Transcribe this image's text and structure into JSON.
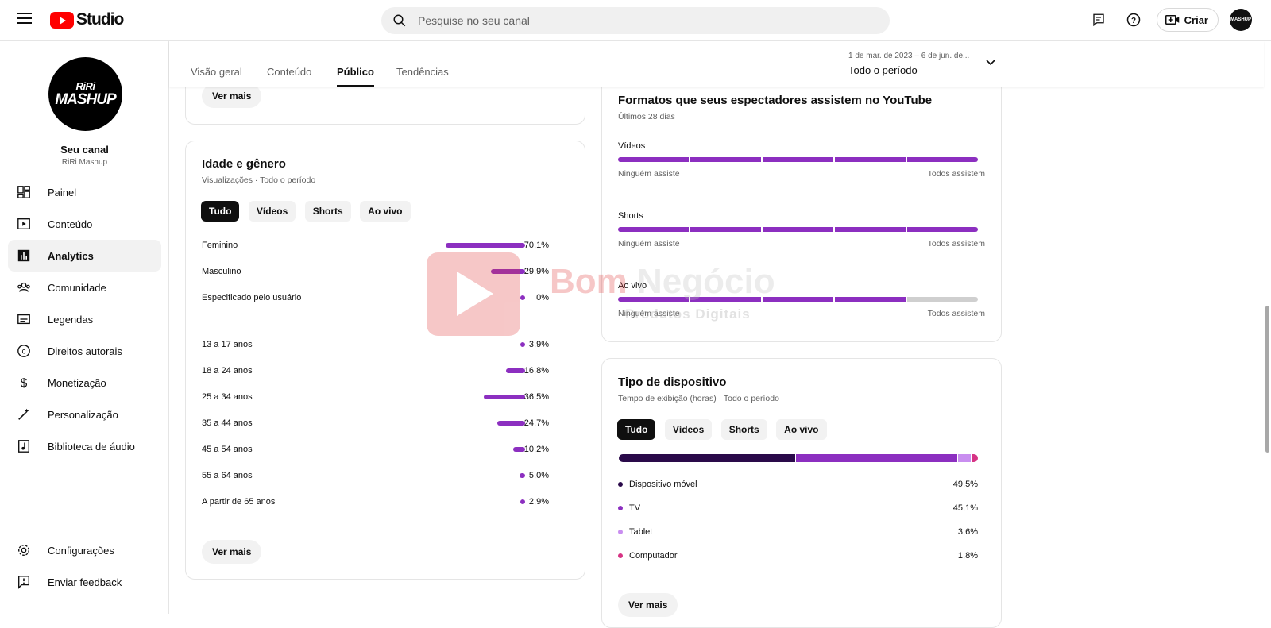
{
  "app": {
    "logo_text": "Studio"
  },
  "search": {
    "placeholder": "Pesquise no seu canal"
  },
  "topbar": {
    "create_label": "Criar",
    "avatar_text": "MASHUP"
  },
  "channel": {
    "avatar_line1": "RiRi",
    "avatar_line2": "MASHUP",
    "title": "Seu canal",
    "name": "RiRi Mashup"
  },
  "sidebar": {
    "items": [
      {
        "label": "Painel",
        "icon": "dashboard-icon"
      },
      {
        "label": "Conteúdo",
        "icon": "content-icon"
      },
      {
        "label": "Analytics",
        "icon": "analytics-icon",
        "active": true
      },
      {
        "label": "Comunidade",
        "icon": "community-icon"
      },
      {
        "label": "Legendas",
        "icon": "subtitles-icon"
      },
      {
        "label": "Direitos autorais",
        "icon": "copyright-icon"
      },
      {
        "label": "Monetização",
        "icon": "monetization-icon"
      },
      {
        "label": "Personalização",
        "icon": "customization-icon"
      },
      {
        "label": "Biblioteca de áudio",
        "icon": "audio-library-icon"
      }
    ],
    "bottom": [
      {
        "label": "Configurações",
        "icon": "settings-icon"
      },
      {
        "label": "Enviar feedback",
        "icon": "feedback-icon"
      }
    ]
  },
  "tabs": [
    {
      "label": "Visão geral"
    },
    {
      "label": "Conteúdo"
    },
    {
      "label": "Público",
      "active": true
    },
    {
      "label": "Tendências"
    }
  ],
  "period": {
    "range": "1 de mar. de 2023 – 6 de jun. de...",
    "label": "Todo o período"
  },
  "top_card": {
    "more_label": "Ver mais"
  },
  "age_gender": {
    "title": "Idade e gênero",
    "subtitle": "Visualizações · Todo o período",
    "chips": [
      "Tudo",
      "Vídeos",
      "Shorts",
      "Ao vivo"
    ],
    "gender": [
      {
        "label": "Feminino",
        "value": "70,1%",
        "pct": 70.1
      },
      {
        "label": "Masculino",
        "value": "29,9%",
        "pct": 29.9
      },
      {
        "label": "Especificado pelo usuário",
        "value": "0%",
        "pct": 0
      }
    ],
    "ages": [
      {
        "label": "13 a 17 anos",
        "value": "3,9%",
        "pct": 3.9
      },
      {
        "label": "18 a 24 anos",
        "value": "16,8%",
        "pct": 16.8
      },
      {
        "label": "25 a 34 anos",
        "value": "36,5%",
        "pct": 36.5
      },
      {
        "label": "35 a 44 anos",
        "value": "24,7%",
        "pct": 24.7
      },
      {
        "label": "45 a 54 anos",
        "value": "10,2%",
        "pct": 10.2
      },
      {
        "label": "55 a 64 anos",
        "value": "5,0%",
        "pct": 5.0
      },
      {
        "label": "A partir de 65 anos",
        "value": "2,9%",
        "pct": 2.9
      }
    ],
    "more_label": "Ver mais"
  },
  "formats": {
    "title": "Formatos que seus espectadores assistem no YouTube",
    "subtitle": "Últimos 28 dias",
    "low_label": "Ninguém assiste",
    "high_label": "Todos assistem",
    "rows": [
      {
        "label": "Vídeos",
        "filled_segments": 5
      },
      {
        "label": "Shorts",
        "filled_segments": 5
      },
      {
        "label": "Ao vivo",
        "filled_segments": 4
      }
    ]
  },
  "devices": {
    "title": "Tipo de dispositivo",
    "subtitle": "Tempo de exibição (horas) · Todo o período",
    "chips": [
      "Tudo",
      "Vídeos",
      "Shorts",
      "Ao vivo"
    ],
    "items": [
      {
        "label": "Dispositivo móvel",
        "value": "49,5%",
        "pct": 49.5,
        "color": "#2a0a4a"
      },
      {
        "label": "TV",
        "value": "45,1%",
        "pct": 45.1,
        "color": "#8c2fc0"
      },
      {
        "label": "Tablet",
        "value": "3,6%",
        "pct": 3.6,
        "color": "#c98ef0"
      },
      {
        "label": "Computador",
        "value": "1,8%",
        "pct": 1.8,
        "color": "#d63384"
      }
    ],
    "more_label": "Ver mais"
  },
  "watermark": {
    "word1": "Bom",
    "word2": "Negócio",
    "sub": "Produtos Digitais"
  }
}
